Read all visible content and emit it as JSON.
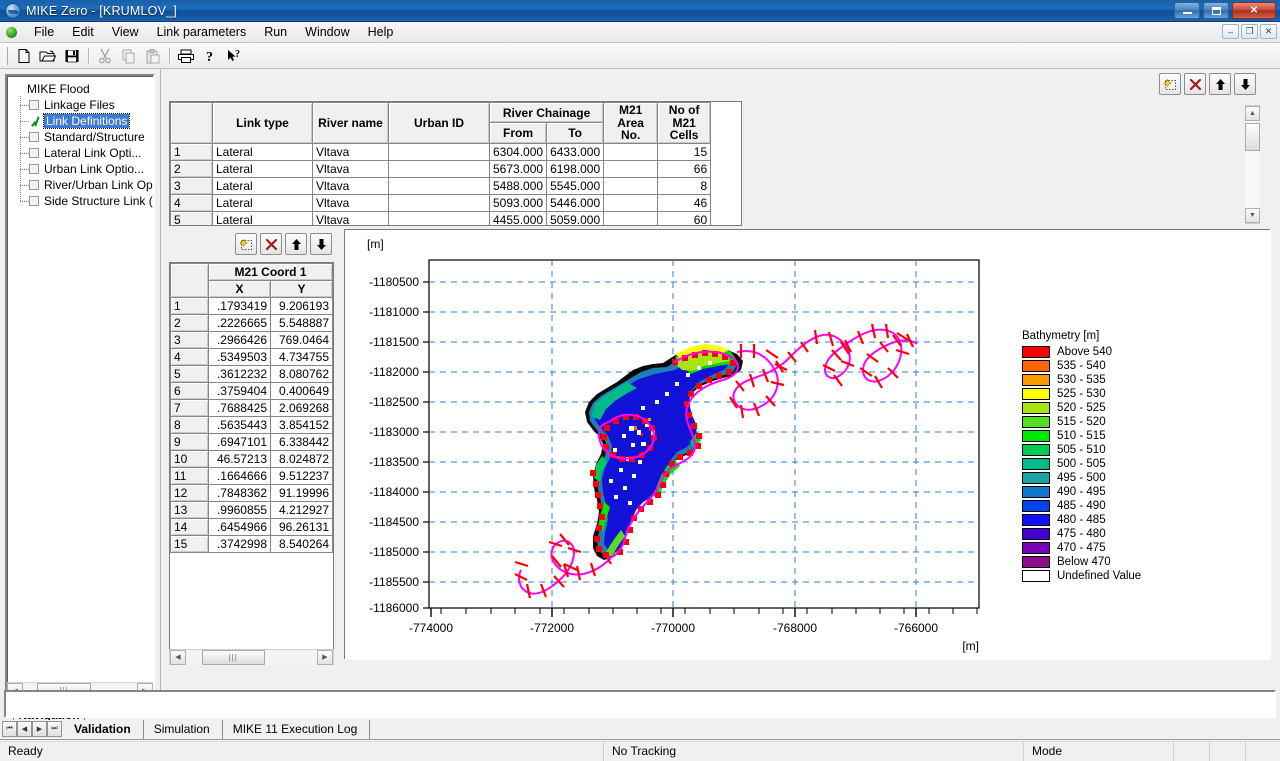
{
  "window": {
    "title": "MIKE Zero - [KRUMLOV_]",
    "app_icon": "mike-zero-icon",
    "minimize_label": "–",
    "maximize_label": "❐",
    "close_label": "✕"
  },
  "mdi_buttons": {
    "minimize": "–",
    "restore": "❐",
    "close": "✕"
  },
  "menu": {
    "status_dot": "green-status-dot",
    "items": [
      {
        "label": "File"
      },
      {
        "label": "Edit"
      },
      {
        "label": "View"
      },
      {
        "label": "Link parameters"
      },
      {
        "label": "Run"
      },
      {
        "label": "Window"
      },
      {
        "label": "Help"
      }
    ]
  },
  "toolbar": {
    "buttons": [
      {
        "name": "new-file-icon",
        "glyph": "὜B"
      },
      {
        "name": "open-folder-icon",
        "glyph": "open"
      },
      {
        "name": "save-icon",
        "glyph": "save"
      },
      {
        "name": "cut-icon",
        "glyph": "cut"
      },
      {
        "name": "copy-icon",
        "glyph": "copy"
      },
      {
        "name": "paste-icon",
        "glyph": "paste"
      },
      {
        "name": "print-icon",
        "glyph": "print"
      },
      {
        "name": "help-icon",
        "glyph": "?"
      },
      {
        "name": "context-help-icon",
        "glyph": "k?"
      }
    ]
  },
  "navigation": {
    "tab_label": "Navigation",
    "root": "MIKE Flood",
    "items": [
      {
        "label": "Linkage Files",
        "checked": false,
        "selected": false
      },
      {
        "label": "Link Definitions",
        "checked": true,
        "selected": true
      },
      {
        "label": "Standard/Structure",
        "checked": false,
        "selected": false
      },
      {
        "label": "Lateral Link Opti...",
        "checked": false,
        "selected": false
      },
      {
        "label": "Urban Link Optio...",
        "checked": false,
        "selected": false
      },
      {
        "label": "River/Urban Link Op",
        "checked": false,
        "selected": false
      },
      {
        "label": "Side Structure Link (",
        "checked": false,
        "selected": false
      }
    ]
  },
  "link_table": {
    "toolbar": [
      {
        "name": "insert-row-button",
        "glyph": "insert"
      },
      {
        "name": "delete-row-button",
        "glyph": "delete"
      },
      {
        "name": "move-up-button",
        "glyph": "up"
      },
      {
        "name": "move-down-button",
        "glyph": "down"
      }
    ],
    "headers": {
      "row_index": "",
      "link_type": "Link type",
      "river_name": "River name",
      "urban_id": "Urban ID",
      "river_chainage": "River Chainage",
      "chainage_from": "From",
      "chainage_to": "To",
      "m21_area_no": "M21 Area No.",
      "no_of_m21_cells": "No of M21 Cells"
    },
    "rows": [
      {
        "idx": "1",
        "link_type": "Lateral",
        "river_name": "Vltava",
        "urban_id": "",
        "from": "6304.000",
        "to": "6433.000",
        "area_no": "",
        "cells": "15"
      },
      {
        "idx": "2",
        "link_type": "Lateral",
        "river_name": "Vltava",
        "urban_id": "",
        "from": "5673.000",
        "to": "6198.000",
        "area_no": "",
        "cells": "66"
      },
      {
        "idx": "3",
        "link_type": "Lateral",
        "river_name": "Vltava",
        "urban_id": "",
        "from": "5488.000",
        "to": "5545.000",
        "area_no": "",
        "cells": "8"
      },
      {
        "idx": "4",
        "link_type": "Lateral",
        "river_name": "Vltava",
        "urban_id": "",
        "from": "5093.000",
        "to": "5446.000",
        "area_no": "",
        "cells": "46"
      },
      {
        "idx": "5",
        "link_type": "Lateral",
        "river_name": "Vltava",
        "urban_id": "",
        "from": "4455.000",
        "to": "5059.000",
        "area_no": "",
        "cells": "60"
      }
    ]
  },
  "coord_table": {
    "toolbar": [
      {
        "name": "insert-row-button",
        "glyph": "insert"
      },
      {
        "name": "delete-row-button",
        "glyph": "delete"
      },
      {
        "name": "move-up-button",
        "glyph": "up"
      },
      {
        "name": "move-down-button",
        "glyph": "down"
      }
    ],
    "headers": {
      "row_index": "",
      "group": "M21 Coord 1",
      "x": "X",
      "y": "Y"
    },
    "rows": [
      {
        "idx": "1",
        "x": ".1793419",
        "y": "9.206193"
      },
      {
        "idx": "2",
        "x": ".2226665",
        "y": "5.548887"
      },
      {
        "idx": "3",
        "x": ".2966426",
        "y": "769.0464"
      },
      {
        "idx": "4",
        "x": ".5349503",
        "y": "4.734755"
      },
      {
        "idx": "5",
        "x": ".3612232",
        "y": "8.080762"
      },
      {
        "idx": "6",
        "x": ".3759404",
        "y": "0.400649"
      },
      {
        "idx": "7",
        "x": ".7688425",
        "y": "2.069268"
      },
      {
        "idx": "8",
        "x": ".5635443",
        "y": "3.854152"
      },
      {
        "idx": "9",
        "x": ".6947101",
        "y": "6.338442"
      },
      {
        "idx": "10",
        "x": "46.57213",
        "y": "8.024872"
      },
      {
        "idx": "11",
        "x": ".1664666",
        "y": "9.512237"
      },
      {
        "idx": "12",
        "x": ".7848362",
        "y": "91.19996"
      },
      {
        "idx": "13",
        "x": ".9960855",
        "y": "4.212927"
      },
      {
        "idx": "14",
        "x": ".6454966",
        "y": "96.26131"
      },
      {
        "idx": "15",
        "x": ".3742998",
        "y": "8.540264"
      }
    ]
  },
  "chart_data": {
    "type": "scatter",
    "title": "",
    "xlabel": "[m]",
    "ylabel": "[m]",
    "xlim": [
      -774800,
      -764600
    ],
    "ylim": [
      -1186200,
      -1180300
    ],
    "grid": true,
    "xticks": [
      -774000,
      -772000,
      -770000,
      -768000,
      -766000
    ],
    "xtick_labels": [
      "-774000",
      "-772000",
      "-770000",
      "-768000",
      "-766000"
    ],
    "yticks": [
      -1180500,
      -1181000,
      -1181500,
      -1182000,
      -1182500,
      -1183000,
      -1183500,
      -1184000,
      -1184500,
      -1185000,
      -1185500,
      -1186000
    ],
    "ytick_labels": [
      "-1180500",
      "-1181000",
      "-1181500",
      "-1182000",
      "-1182500",
      "-1183000",
      "-1183500",
      "-1184000",
      "-1184500",
      "-1185000",
      "-1185500",
      "-1186000"
    ],
    "grid_color": "#2e7fd4",
    "series": [
      {
        "name": "Bathymetry raster",
        "type": "heatmap"
      },
      {
        "name": "River network (MIKE 11)",
        "type": "line",
        "color": "#ff00ff",
        "marker_color": "#ff0000"
      },
      {
        "name": "Lateral links",
        "type": "scatter",
        "color": "#ff0000"
      }
    ],
    "legend": {
      "position": "right",
      "title": "Bathymetry [m]",
      "entries": [
        {
          "label": "Above 540",
          "color": "#ff0000"
        },
        {
          "label": "535 - 540",
          "color": "#ff6600"
        },
        {
          "label": "530 - 535",
          "color": "#ff9900"
        },
        {
          "label": "525 - 530",
          "color": "#ffff00"
        },
        {
          "label": "520 - 525",
          "color": "#a6e510"
        },
        {
          "label": "515 - 520",
          "color": "#55dd22"
        },
        {
          "label": "510 - 515",
          "color": "#00e800"
        },
        {
          "label": "505 - 510",
          "color": "#00cc55"
        },
        {
          "label": "500 - 505",
          "color": "#00bb88"
        },
        {
          "label": "495 - 500",
          "color": "#19a3a3"
        },
        {
          "label": "490 - 495",
          "color": "#1177cc"
        },
        {
          "label": "485 - 490",
          "color": "#0044ee"
        },
        {
          "label": "480 - 485",
          "color": "#1111ff"
        },
        {
          "label": "475 - 480",
          "color": "#4400cc"
        },
        {
          "label": "470 - 475",
          "color": "#7700bb"
        },
        {
          "label": "Below  470",
          "color": "#8b0f8b"
        },
        {
          "label": "Undefined Value",
          "color": "#ffffff"
        }
      ]
    }
  },
  "tabstrip": {
    "nav_buttons": [
      {
        "name": "tab-first-button",
        "glyph": "⏮"
      },
      {
        "name": "tab-prev-button",
        "glyph": "◀"
      },
      {
        "name": "tab-next-button",
        "glyph": "▶"
      },
      {
        "name": "tab-last-button",
        "glyph": "⏭"
      }
    ],
    "tabs": [
      {
        "label": "Validation",
        "active": true
      },
      {
        "label": "Simulation",
        "active": false
      },
      {
        "label": "MIKE 11 Execution Log",
        "active": false
      }
    ]
  },
  "statusbar": {
    "ready": "Ready",
    "tracking": "No Tracking",
    "mode": "Mode"
  }
}
